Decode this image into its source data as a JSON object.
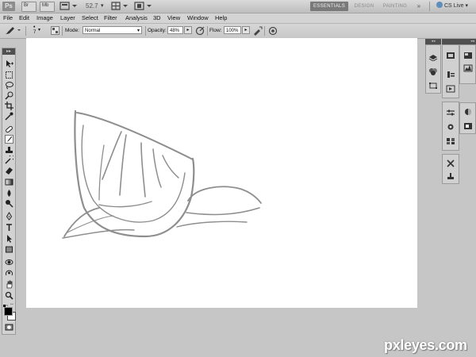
{
  "app": {
    "logo": "Ps",
    "zoom_value": "52.7",
    "workspaces": [
      "ESSENTIALS",
      "DESIGN",
      "PAINTING"
    ],
    "workspaces_more": "»",
    "cs_live": "CS Live"
  },
  "menubar": {
    "items": [
      "File",
      "Edit",
      "Image",
      "Layer",
      "Select",
      "Filter",
      "Analysis",
      "3D",
      "View",
      "Window",
      "Help"
    ]
  },
  "options": {
    "brush_size": "7",
    "mode_label": "Mode:",
    "mode_value": "Normal",
    "opacity_label": "Opacity:",
    "opacity_value": "48%",
    "flow_label": "Flow:",
    "flow_value": "100%"
  },
  "panels": {
    "collapse_glyph": "◂◂",
    "expand_glyph": "▸▸"
  },
  "colors": {
    "foreground": "#000000",
    "background": "#ffffff",
    "active_workspace": "#7a7a7a",
    "sketch_stroke": "#8e8e8e"
  },
  "watermark": "pxleyes.com"
}
